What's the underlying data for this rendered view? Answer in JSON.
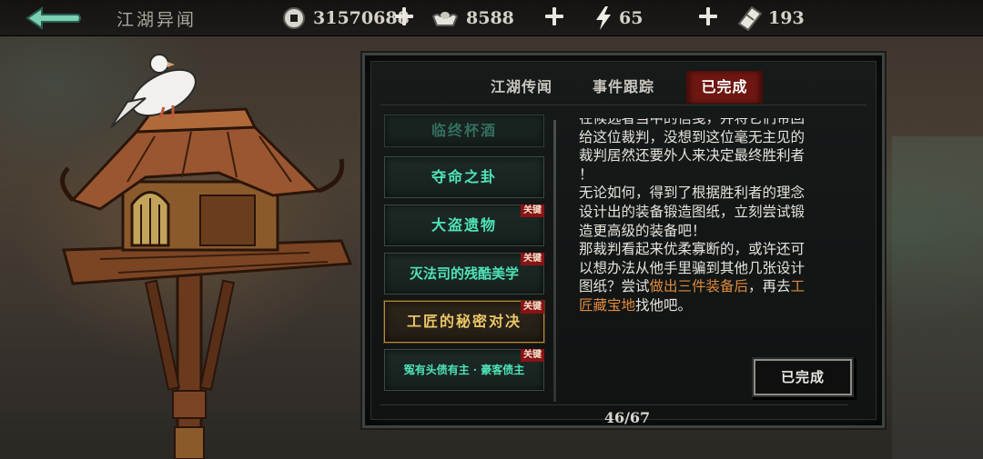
{
  "header": {
    "title": "江湖异闻",
    "resources": [
      {
        "name": "coin",
        "icon": "copper-coin-icon",
        "value": "31570688"
      },
      {
        "name": "silver",
        "icon": "silver-ingot-icon",
        "value": "8588"
      },
      {
        "name": "energy",
        "icon": "lightning-icon",
        "value": "65"
      },
      {
        "name": "ticket",
        "icon": "ticket-icon",
        "value": "193"
      }
    ]
  },
  "tabs": [
    {
      "label": "江湖传闻",
      "active": false
    },
    {
      "label": "事件跟踪",
      "active": false
    },
    {
      "label": "已完成",
      "active": true
    }
  ],
  "quests": [
    {
      "label": "临终杯酒",
      "key": false
    },
    {
      "label": "夺命之卦",
      "key": false
    },
    {
      "label": "大盗遗物",
      "key": true
    },
    {
      "label": "灭法司的残酷美学",
      "key": true
    },
    {
      "label": "工匠的秘密对决",
      "key": true,
      "selected": true
    },
    {
      "label": "冤有头债有主 · 豪客债主",
      "key": true
    }
  ],
  "key_badge": "关键",
  "description": {
    "cut_line": "在候选者当中的信笺，并将它们带回",
    "lines": [
      "给这位裁判，没想到这位毫无主见的",
      "裁判居然还要外人来决定最终胜利者",
      "！",
      "无论如何，得到了根据胜利者的理念",
      "设计出的装备锻造图纸，立刻尝试锻",
      "造更高级的装备吧！",
      "那裁判看起来优柔寡断的，或许还可",
      "以想办法从他手里骗到其他几张设计",
      "图纸？尝试"
    ],
    "highlight_1": "做出三件装备后",
    "mid_text": "，再去",
    "highlight_2_a": "工",
    "highlight_2_b": "匠藏宝地",
    "end_text": "找他吧。"
  },
  "status_button": "已完成",
  "pagination": "46/67",
  "colors": {
    "accent_green": "#4fe3b8",
    "selected_gold": "#e9c667",
    "active_tab_red": "#6e1612",
    "highlight_orange": "#e08a3e"
  }
}
